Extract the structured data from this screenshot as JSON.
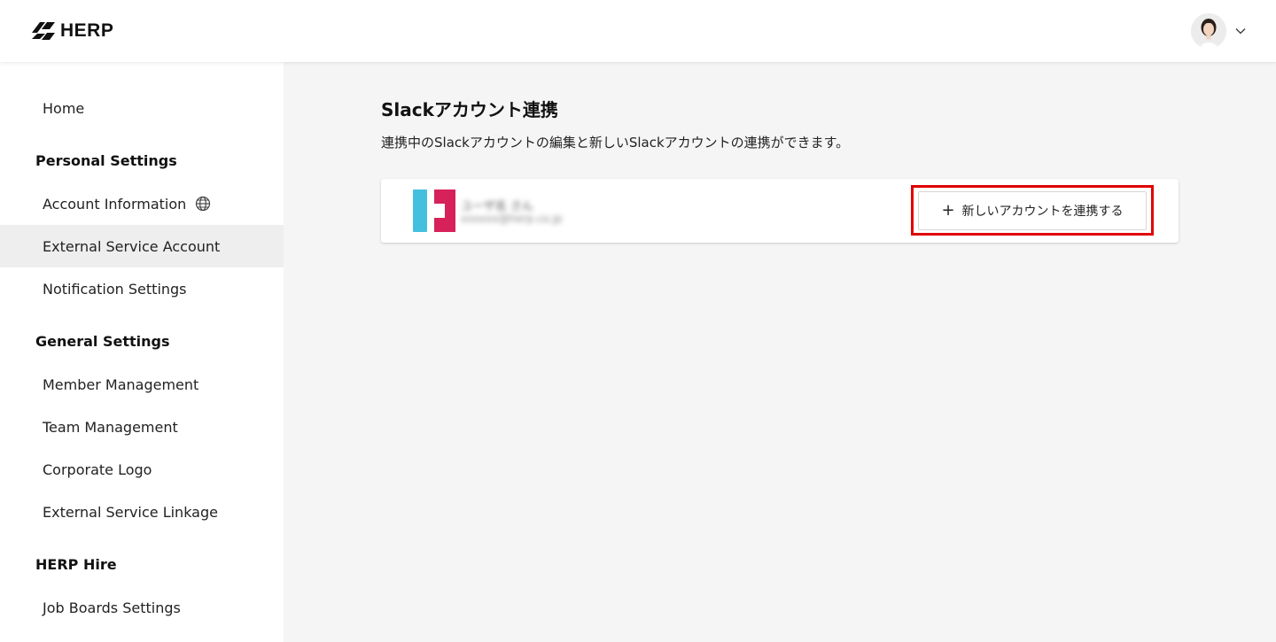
{
  "header": {
    "logo_text": "HERP"
  },
  "sidebar": {
    "home": "Home",
    "personal_heading": "Personal Settings",
    "account_information": "Account Information",
    "external_service_account": "External Service Account",
    "notification_settings": "Notification Settings",
    "general_heading": "General Settings",
    "member_management": "Member Management",
    "team_management": "Team Management",
    "corporate_logo": "Corporate Logo",
    "external_service_linkage": "External Service Linkage",
    "hire_heading": "HERP Hire",
    "job_boards_settings": "Job Boards Settings"
  },
  "main": {
    "title": "Slackアカウント連携",
    "description": "連携中のSlackアカウントの編集と新しいSlackアカウントの連携ができます。",
    "account": {
      "name": "ユーザ名 さん",
      "email": "xxxxxx@herp.co.jp"
    },
    "add_button_label": "新しいアカウントを連携する"
  },
  "colors": {
    "highlight": "#e00000",
    "active_bg": "#eeeeee",
    "ws_icon_blue": "#44bfe0",
    "ws_icon_red": "#d6215a"
  },
  "icons": {
    "logo": "herp-logo-icon",
    "globe": "globe-icon",
    "chevron": "chevron-down-icon",
    "plus": "plus-icon"
  }
}
